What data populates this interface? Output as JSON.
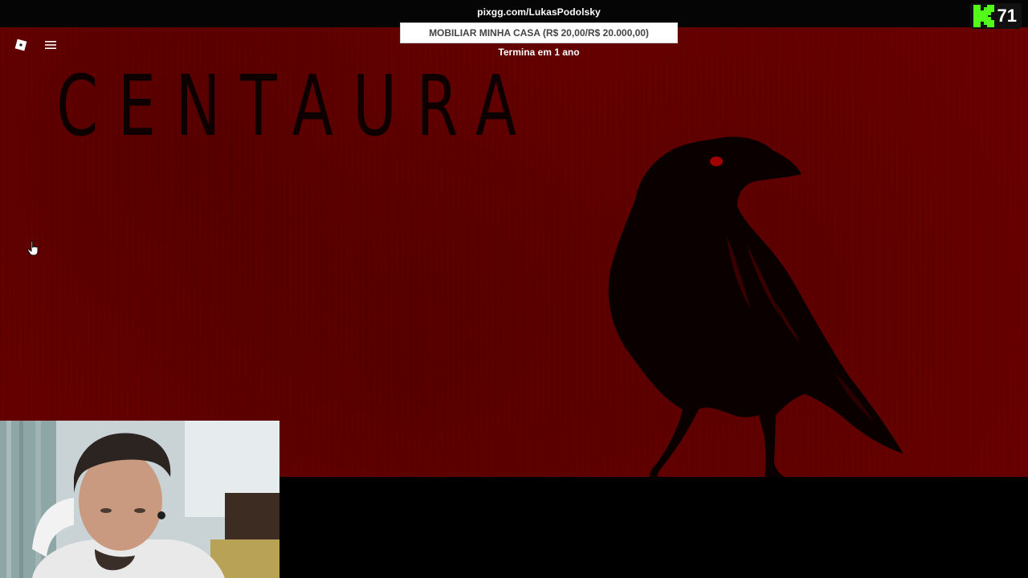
{
  "stream": {
    "url": "pixgg.com/LukasPodolsky",
    "goal_label": "MOBILIAR MINHA CASA (R$ 20,00/R$ 20.000,00)",
    "goal_progress": 0.001,
    "goal_subtitle": "Termina em 1 ano",
    "viewer_count": "71"
  },
  "game": {
    "title": "CENTAURA",
    "icons": {
      "roblox": "roblox-icon",
      "menu": "hamburger-menu-icon",
      "cursor": "hand-pointer-icon",
      "crow": "crow-silhouette",
      "kick": "kick-logo-icon"
    }
  },
  "colors": {
    "background_red": "#6a0000",
    "crow_eye": "#a00000",
    "kick_green": "#53fc18",
    "top_bar": "#050505"
  }
}
